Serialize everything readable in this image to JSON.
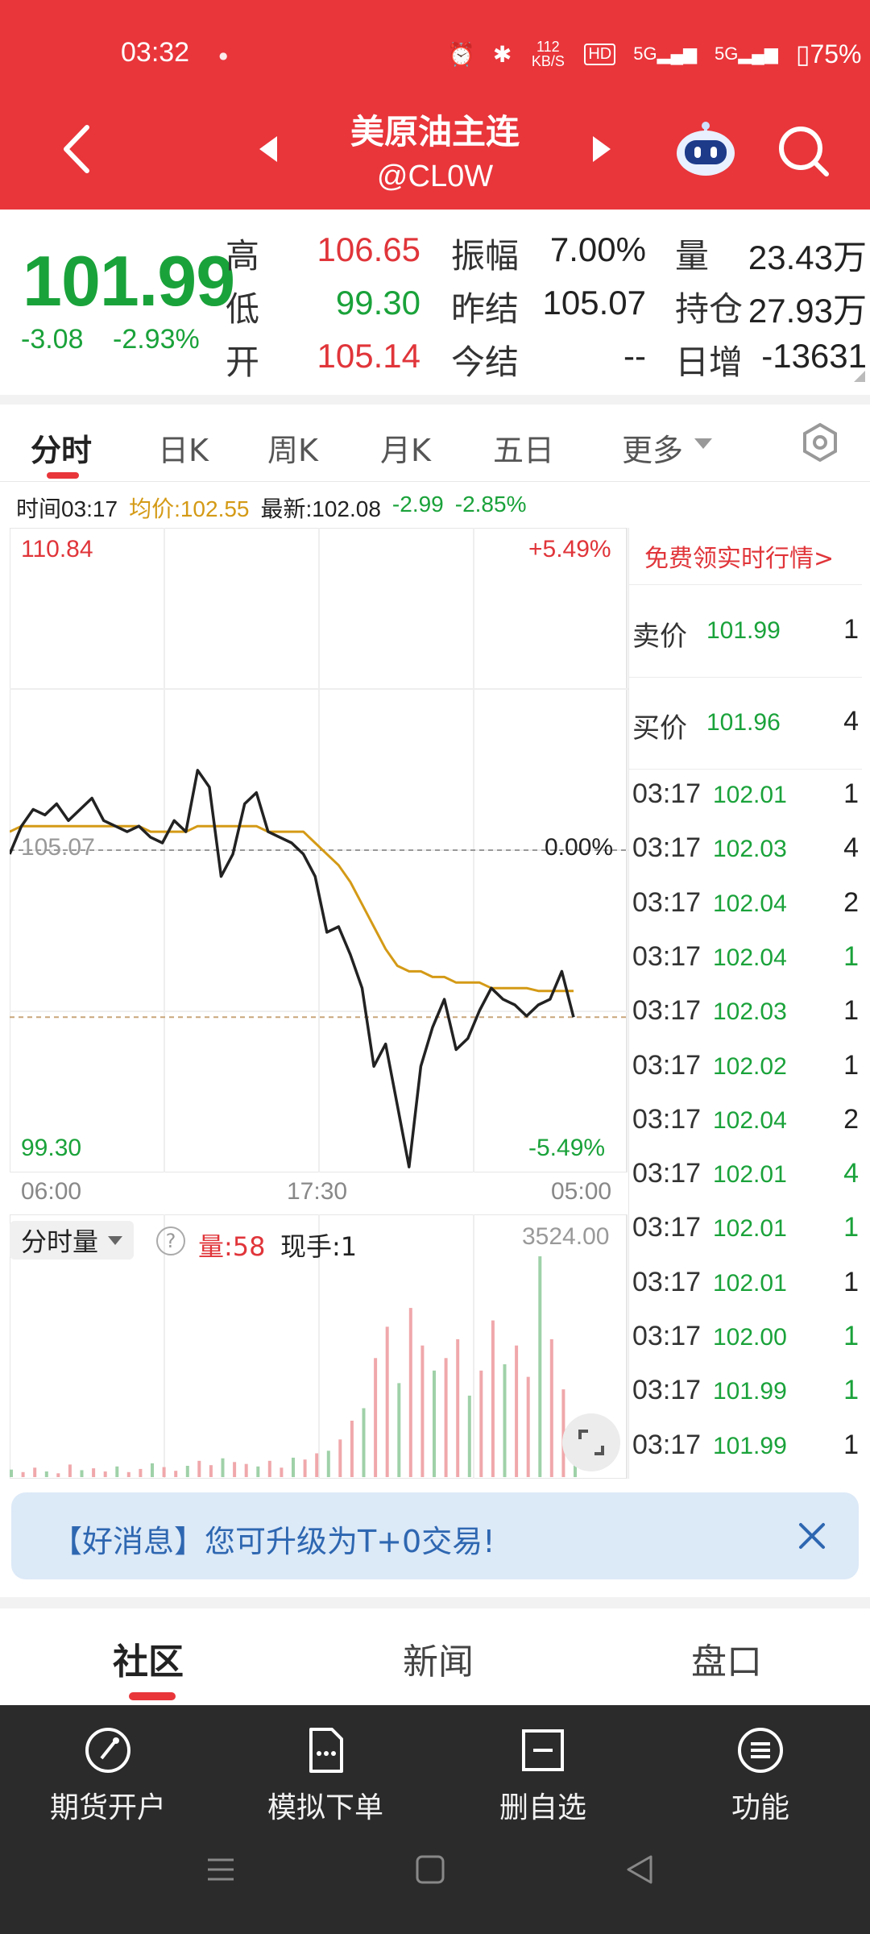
{
  "status_bar": {
    "time": "03:32",
    "mini_logo": "xiaohongshu",
    "speed": "112 KB/S",
    "hd": "HD",
    "signal1": "5G",
    "signal2": "5G",
    "battery": "75%"
  },
  "header": {
    "title": "美原油主连",
    "code": "@CL0W"
  },
  "quote": {
    "price": "101.99",
    "change": "-3.08",
    "change_pct": "-2.93%",
    "fields": {
      "high_label": "高",
      "high": "106.65",
      "low_label": "低",
      "low": "99.30",
      "open_label": "开",
      "open": "105.14",
      "amp_label": "振幅",
      "amp": "7.00%",
      "prev_settle_label": "昨结",
      "prev_settle": "105.07",
      "today_settle_label": "今结",
      "today_settle": "--",
      "vol_label": "量",
      "vol": "23.43万",
      "oi_label": "持仓",
      "oi": "27.93万",
      "daily_inc_label": "日增",
      "daily_inc": "-13631"
    }
  },
  "tabs": {
    "items": [
      "分时",
      "日K",
      "周K",
      "月K",
      "五日",
      "更多"
    ],
    "active": "分时"
  },
  "info_line": {
    "time_label": "时间03:17",
    "avg_label": "均价:102.55",
    "last_label": "最新:102.08",
    "change": "-2.99",
    "change_pct": "-2.85%"
  },
  "chart_labels": {
    "y_high": "110.84",
    "y_low": "99.30",
    "y_mid": "105.07",
    "pct_high": "+5.49%",
    "pct_mid": "0.00%",
    "pct_low": "-5.49%",
    "x_ticks": [
      "06:00",
      "17:30",
      "05:00"
    ]
  },
  "chart_data": {
    "type": "line",
    "title": "",
    "ylim": [
      99.3,
      110.84
    ],
    "ref_value": 105.07,
    "series": [
      {
        "name": "",
        "color": "#222222",
        "values": [
          105.0,
          105.5,
          105.8,
          105.7,
          105.9,
          105.6,
          105.8,
          106.0,
          105.6,
          105.5,
          105.4,
          105.5,
          105.3,
          105.2,
          105.6,
          105.4,
          106.5,
          106.2,
          104.6,
          105.0,
          105.9,
          106.1,
          105.4,
          105.3,
          105.2,
          105.0,
          104.6,
          103.6,
          103.7,
          103.2,
          102.6,
          101.2,
          101.6,
          100.5,
          99.4,
          101.2,
          101.9,
          102.4,
          101.5,
          101.7,
          102.2,
          102.6,
          102.4,
          102.3,
          102.1,
          102.3,
          102.4,
          102.9,
          102.08
        ]
      },
      {
        "name": "均价",
        "color": "#d49a16",
        "values": [
          105.4,
          105.5,
          105.5,
          105.5,
          105.5,
          105.5,
          105.5,
          105.5,
          105.5,
          105.5,
          105.5,
          105.5,
          105.4,
          105.4,
          105.4,
          105.4,
          105.5,
          105.5,
          105.5,
          105.5,
          105.5,
          105.5,
          105.4,
          105.4,
          105.4,
          105.4,
          105.2,
          105.0,
          104.8,
          104.5,
          104.1,
          103.7,
          103.3,
          103.0,
          102.9,
          102.9,
          102.8,
          102.8,
          102.7,
          102.7,
          102.7,
          102.6,
          102.6,
          102.6,
          102.6,
          102.55,
          102.55,
          102.55,
          102.55
        ]
      }
    ],
    "volume": {
      "max": 3524.0,
      "values": [
        120,
        80,
        150,
        90,
        60,
        200,
        110,
        140,
        90,
        170,
        80,
        130,
        220,
        160,
        100,
        180,
        260,
        190,
        300,
        240,
        210,
        170,
        260,
        150,
        310,
        280,
        380,
        420,
        600,
        900,
        1100,
        1900,
        2400,
        1500,
        2700,
        2100,
        1700,
        1900,
        2200,
        1300,
        1700,
        2500,
        1800,
        2100,
        1600,
        3524,
        2200,
        1400,
        800
      ]
    }
  },
  "order_book": {
    "free_link": "免费领实时行情>",
    "ask_label": "卖价",
    "ask_price": "101.99",
    "ask_vol": "1",
    "bid_label": "买价",
    "bid_price": "101.96",
    "bid_vol": "4",
    "ticks": [
      {
        "time": "03:17",
        "price": "102.01",
        "vol": "1",
        "color": "#222222"
      },
      {
        "time": "03:17",
        "price": "102.03",
        "vol": "4",
        "color": "#222222"
      },
      {
        "time": "03:17",
        "price": "102.04",
        "vol": "2",
        "color": "#222222"
      },
      {
        "time": "03:17",
        "price": "102.04",
        "vol": "1",
        "color": "#1aa23a"
      },
      {
        "time": "03:17",
        "price": "102.03",
        "vol": "1",
        "color": "#222222"
      },
      {
        "time": "03:17",
        "price": "102.02",
        "vol": "1",
        "color": "#222222"
      },
      {
        "time": "03:17",
        "price": "102.04",
        "vol": "2",
        "color": "#222222"
      },
      {
        "time": "03:17",
        "price": "102.01",
        "vol": "4",
        "color": "#1aa23a"
      },
      {
        "time": "03:17",
        "price": "102.01",
        "vol": "1",
        "color": "#1aa23a"
      },
      {
        "time": "03:17",
        "price": "102.01",
        "vol": "1",
        "color": "#222222"
      },
      {
        "time": "03:17",
        "price": "102.00",
        "vol": "1",
        "color": "#1aa23a"
      },
      {
        "time": "03:17",
        "price": "101.99",
        "vol": "1",
        "color": "#1aa23a"
      },
      {
        "time": "03:17",
        "price": "101.99",
        "vol": "1",
        "color": "#222222"
      }
    ]
  },
  "volume_panel": {
    "selector": "分时量",
    "amount_label": "量:58",
    "hand_label": "现手:1",
    "max_label": "3524.00"
  },
  "banner": {
    "text": "【好消息】您可升级为T+0交易!"
  },
  "bottom_tabs": {
    "items": [
      "社区",
      "新闻",
      "盘口"
    ],
    "active": "社区"
  },
  "bottom_nav": {
    "items": [
      "期货开户",
      "模拟下单",
      "删自选",
      "功能"
    ]
  },
  "colors": {
    "brand_red": "#e8363b",
    "down_green": "#1aa23a",
    "up_red": "#e0353a",
    "avg_gold": "#d49a16"
  }
}
